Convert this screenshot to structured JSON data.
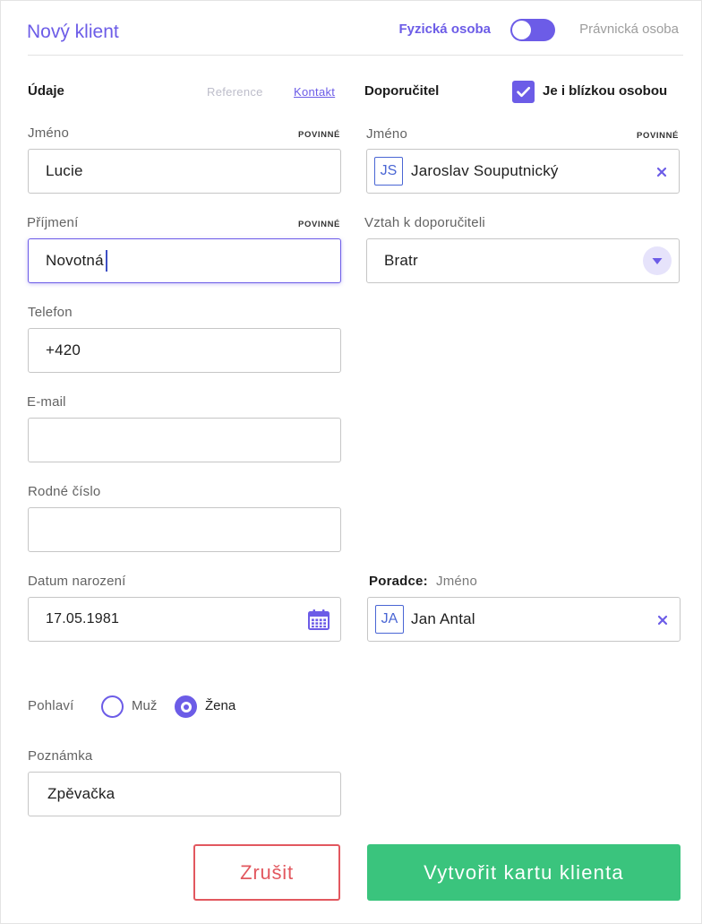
{
  "colors": {
    "accent": "#6c5ce7",
    "badge": "#4a66d4",
    "danger": "#e2585f",
    "success": "#3ac47d"
  },
  "icons": {
    "toggle": "toggle-icon",
    "checkbox": "check-icon",
    "clear": "close-icon",
    "dropdown": "chevron-down-icon",
    "date_picker": "calendar-icon"
  },
  "header": {
    "title": "Nový klient",
    "type_physical": "Fyzická osoba",
    "type_legal": "Právnická osoba",
    "is_legal_entity": false
  },
  "client": {
    "section_title": "Údaje",
    "tabs": [
      {
        "label": "Reference",
        "active": false
      },
      {
        "label": "Kontakt",
        "active": true
      }
    ],
    "first_name": {
      "label": "Jméno",
      "required": "POVINNÉ",
      "value": "Lucie"
    },
    "last_name": {
      "label": "Příjmení",
      "required": "POVINNÉ",
      "value": "Novotná"
    },
    "phone": {
      "label": "Telefon",
      "value": "+420"
    },
    "email": {
      "label": "E-mail",
      "value": ""
    },
    "birth_number": {
      "label": "Rodné číslo",
      "value": ""
    },
    "birth_date": {
      "label": "Datum narození",
      "value": "17.05.1981"
    },
    "gender": {
      "label": "Pohlaví",
      "options": [
        {
          "label": "Muž",
          "selected": false
        },
        {
          "label": "Žena",
          "selected": true
        }
      ]
    },
    "note": {
      "label": "Poznámka",
      "value": "Zpěvačka"
    }
  },
  "referrer": {
    "section_title": "Doporučitel",
    "close_person": {
      "label": "Je i blízkou osobou",
      "checked": true
    },
    "name": {
      "label": "Jméno",
      "required": "POVINNÉ",
      "initials": "JS",
      "value": "Jaroslav Souputnický"
    },
    "relation": {
      "label": "Vztah k doporučiteli",
      "value": "Bratr"
    }
  },
  "advisor": {
    "label": "Poradce:",
    "sublabel": "Jméno",
    "initials": "JA",
    "value": "Jan Antal"
  },
  "actions": {
    "cancel": "Zrušit",
    "submit": "Vytvořit kartu klienta"
  }
}
